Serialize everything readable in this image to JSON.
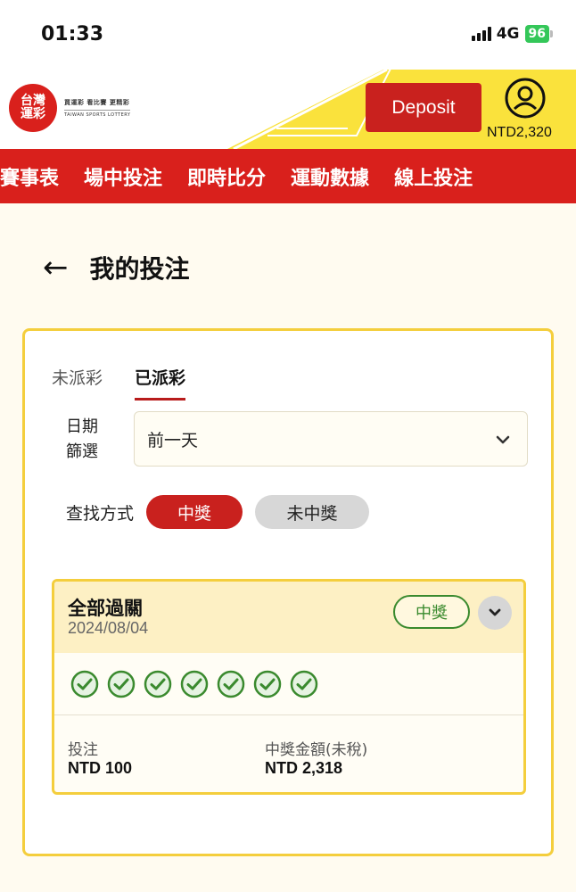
{
  "status_bar": {
    "time": "01:33",
    "network": "4G",
    "battery": "96"
  },
  "header": {
    "logo_text": [
      "台灣",
      "運彩"
    ],
    "logo_tagline": "買運彩 看比賽 更精彩",
    "logo_subtitle": "TAIWAN SPORTS LOTTERY",
    "deposit_label": "Deposit",
    "balance": "NTD2,320"
  },
  "nav": {
    "items": [
      "賽事表",
      "場中投注",
      "即時比分",
      "運動數據",
      "線上投注"
    ]
  },
  "page": {
    "title": "我的投注"
  },
  "tabs": [
    {
      "label": "未派彩",
      "active": false
    },
    {
      "label": "已派彩",
      "active": true
    }
  ],
  "filter": {
    "date_label": "日期\n篩選",
    "date_value": "前一天",
    "search_label": "查找方式",
    "options": [
      "中獎",
      "未中獎"
    ],
    "selected": "中獎"
  },
  "bet": {
    "type": "全部過關",
    "date": "2024/08/04",
    "status": "中獎",
    "legs_won": 7,
    "stake_label": "投注",
    "stake": "NTD 100",
    "payout_label": "中獎金額(未稅)",
    "payout": "NTD 2,318"
  },
  "colors": {
    "brand_red": "#d9201c",
    "accent_yellow": "#f4ce3d",
    "win_green": "#3a8a2e"
  }
}
